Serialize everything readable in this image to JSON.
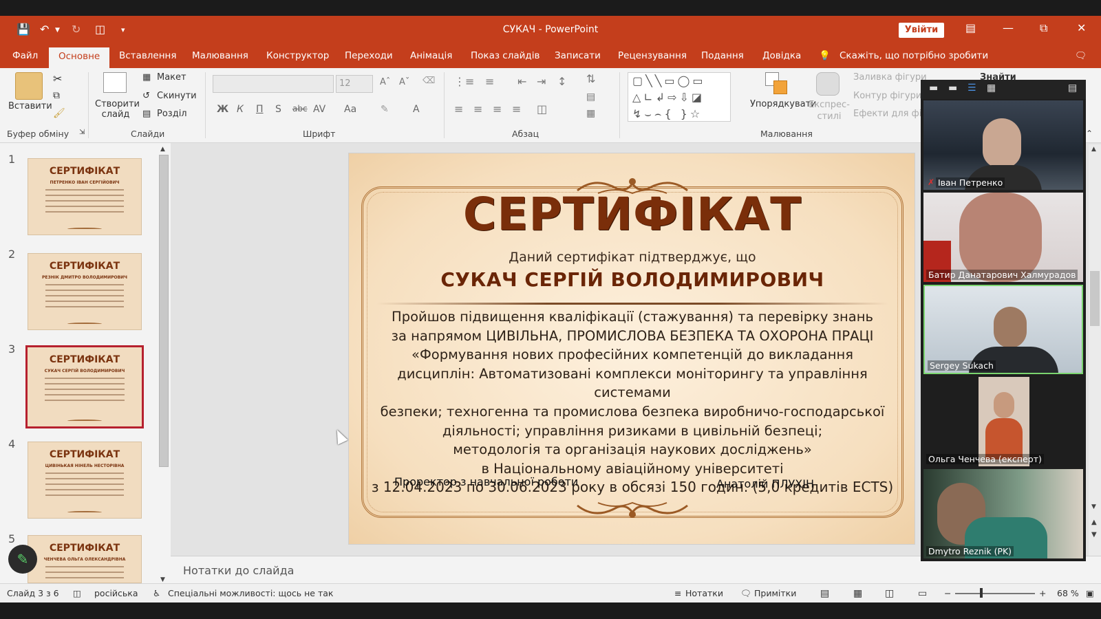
{
  "window": {
    "title": "СУКАЧ  -  PowerPoint",
    "signin_label": "Увійти"
  },
  "ribbon_tabs": [
    "Файл",
    "Основне",
    "Вставлення",
    "Малювання",
    "Конструктор",
    "Переходи",
    "Анімація",
    "Показ слайдів",
    "Записати",
    "Рецензування",
    "Подання",
    "Довідка"
  ],
  "tell_me": "Скажіть, що потрібно зробити",
  "ribbon": {
    "paste_label": "Вставити",
    "clipboard_group": "Буфер обміну",
    "new_slide_label": "Створити слайд",
    "layout_label": "Макет",
    "reset_label": "Скинути",
    "section_label": "Розділ",
    "slides_group": "Слайди",
    "font_group": "Шрифт",
    "font_size": "12",
    "paragraph_group": "Абзац",
    "arrange_label": "Упорядкувати",
    "quick_styles_label": "Експрес-стилі",
    "shape_fill": "Заливка фігури",
    "shape_outline": "Контур фігури",
    "shape_effects": "Ефекти для фігури",
    "find_label": "Знайти",
    "drawing_group": "Малювання"
  },
  "thumbnails": [
    {
      "num": "1",
      "title": "СЕРТИФІКАТ",
      "name": "ПЕТРЕНКО ІВАН СЕРГІЙОВИЧ"
    },
    {
      "num": "2",
      "title": "СЕРТИФІКАТ",
      "name": "РЕЗНІК ДМИТРО ВОЛОДИМИРОВИЧ"
    },
    {
      "num": "3",
      "title": "СЕРТИФІКАТ",
      "name": "СУКАЧ СЕРГІЙ ВОЛОДИМИРОВИЧ"
    },
    {
      "num": "4",
      "title": "СЕРТИФІКАТ",
      "name": "ЦИВІНЬКАЯ НІНЕЛЬ НЕСТОРІВНА"
    },
    {
      "num": "5",
      "title": "СЕРТИФІКАТ",
      "name": "ЧЕНЧЕВА ОЛЬГА ОЛЕКСАНДРІВНА"
    }
  ],
  "slide": {
    "title": "СЕРТИФІКАТ",
    "subtitle": "Даний сертифікат підтверджує, що",
    "name": "СУКАЧ СЕРГІЙ ВОЛОДИМИРОВИЧ",
    "lines": [
      "Пройшов підвищення кваліфікації (стажування) та  перевірку  знань",
      "за напрямом ЦИВІЛЬНА, ПРОМИСЛОВА БЕЗПЕКА ТА ОХОРОНА ПРАЦІ",
      "«Формування нових професійних компетенцій до викладання",
      "дисциплін: Автоматизовані комплекси моніторингу та управління системами",
      "безпеки; техногенна та промислова безпека виробничо-господарської",
      "діяльності; управління ризиками в цивільній безпеці;",
      "методологія та організація наукових досліджень»",
      "в Національному авіаційному університеті",
      "з 12.04.2023 по 30.06.2023 року в обсязі 150 годин. (5,0 кредитів ECTS)"
    ],
    "signer_role": "Проректор з навчальної роботи",
    "signer_name": "Анатолій ПЛУХІН"
  },
  "notes_placeholder": "Нотатки до слайда",
  "status": {
    "slide_counter": "Слайд 3 з 6",
    "language": "російська",
    "accessibility": "Спеціальні можливості: щось не так",
    "notes_label": "Нотатки",
    "comments_label": "Примітки",
    "zoom": "68 %"
  },
  "participants": [
    {
      "name": "Іван Петренко",
      "muted": true
    },
    {
      "name": "Батир Данатарович Халмурадов",
      "muted": false
    },
    {
      "name": "Sergey Sukach",
      "muted": false
    },
    {
      "name": "Ольга Ченчева (експерт)",
      "muted": false
    },
    {
      "name": "Dmytro Reznik (PK)",
      "muted": false
    }
  ],
  "colors": {
    "accent": "#c43e1c",
    "selection": "#b6202e",
    "certificate_title": "#7a2e0a"
  }
}
